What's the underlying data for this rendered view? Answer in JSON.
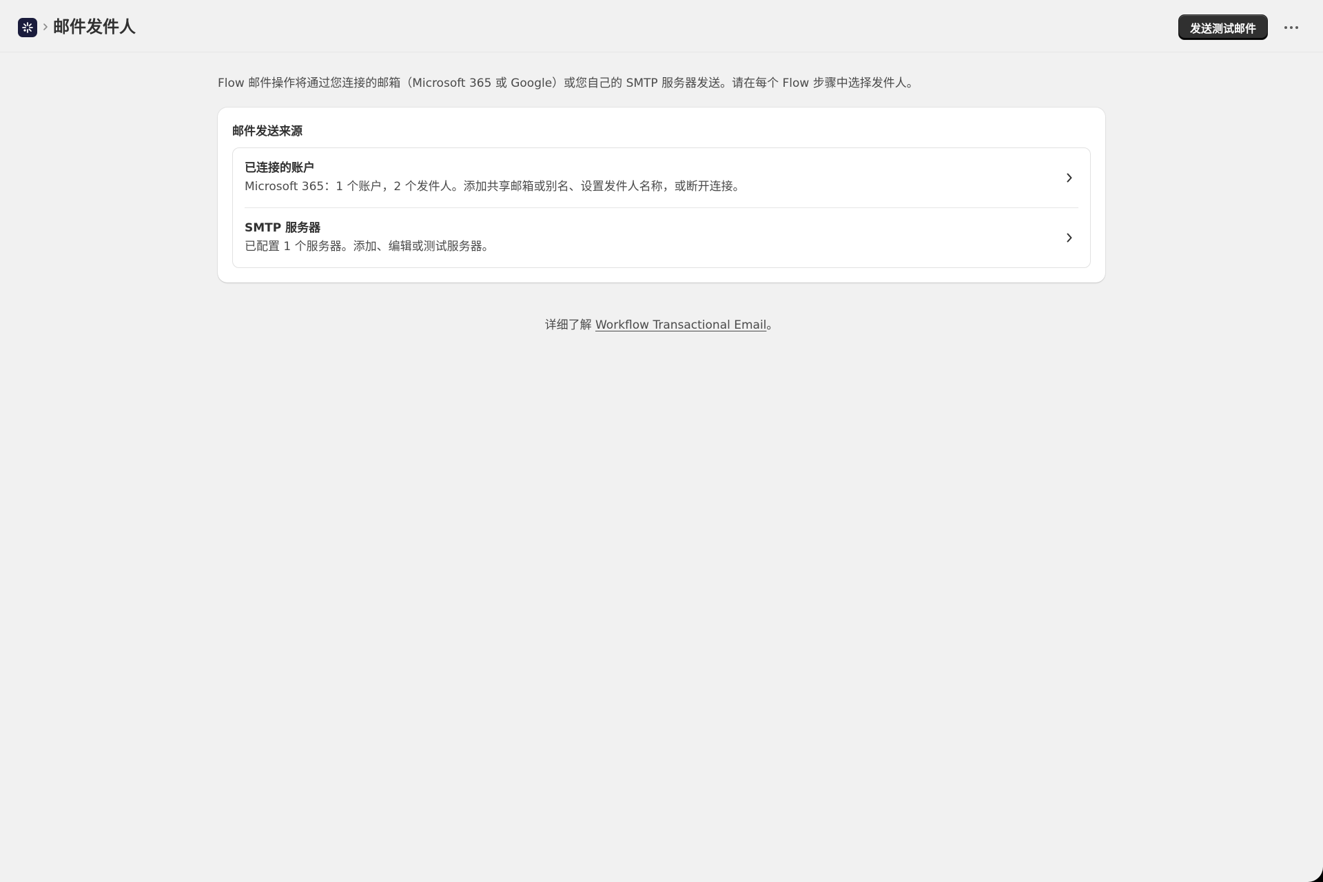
{
  "header": {
    "app_icon": "flow-app-icon",
    "breadcrumb_separator_icon": "chevron-right-icon",
    "title": "邮件发件人",
    "primary_button_label": "发送测试邮件",
    "more_actions_icon": "ellipsis-horizontal-icon"
  },
  "intro_text": "Flow 邮件操作将通过您连接的邮箱（Microsoft 365 或 Google）或您自己的 SMTP 服务器发送。请在每个 Flow 步骤中选择发件人。",
  "card": {
    "title": "邮件发送来源",
    "items": [
      {
        "title": "已连接的账户",
        "description": "Microsoft 365：1 个账户，2 个发件人。添加共享邮箱或别名、设置发件人名称，或断开连接。",
        "icon": "chevron-right-icon"
      },
      {
        "title": "SMTP 服务器",
        "description": "已配置 1 个服务器。添加、编辑或测试服务器。",
        "icon": "chevron-right-icon"
      }
    ]
  },
  "footer": {
    "prefix": "详细了解 ",
    "link_label": "Workflow Transactional Email",
    "suffix": "。"
  },
  "colors": {
    "page_background": "#f1f1f1",
    "card_background": "#ffffff",
    "primary_button": "#303030",
    "app_icon_background": "#1a1c3c"
  }
}
